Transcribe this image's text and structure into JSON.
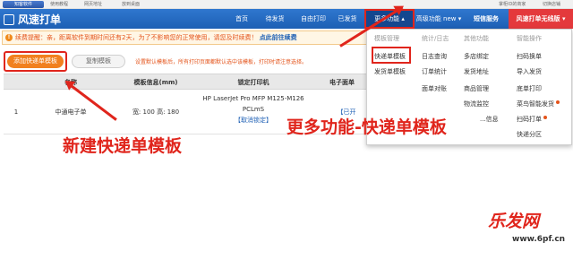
{
  "topbar": {
    "logo": "知客软件",
    "links": [
      "使用教程",
      "网页地址",
      "放到桌面"
    ],
    "user": "掌柜ID的商家",
    "switch": "切换店铺"
  },
  "header": {
    "app_title": "风速打单",
    "nav": [
      {
        "label": "首页"
      },
      {
        "label": "待发货"
      },
      {
        "label": "自由打印"
      },
      {
        "label": "已发货"
      },
      {
        "label": "更多功能 ▴"
      },
      {
        "label": "高级功能 new ▾"
      },
      {
        "label": "短信服务"
      },
      {
        "label": "风速打单无线版 ▾"
      }
    ]
  },
  "notice": {
    "text": "续费提醒：亲，距离软件到期时间还有2天，为了不影响您的正常使用，请您及时续费！",
    "link": "点此前往续费"
  },
  "toolbar": {
    "add_label": "添加快递单模板",
    "copy_label": "复制模板",
    "tip": "设置默认模板后，所有打印页面都默认选中该模板，打印时请注意选择。"
  },
  "table": {
    "headers": [
      "",
      "名称",
      "模板信息(mm)",
      "锁定打印机",
      "电子面单"
    ],
    "rows": [
      {
        "index": "1",
        "name": "中通电子单",
        "size": "宽: 100    高: 180",
        "printer_line1": "HP LaserJet Pro MFP M125-M126",
        "printer_line2": "PCLmS",
        "printer_change": "【取消锁定】",
        "extra": "【已开"
      }
    ]
  },
  "dropdown": {
    "columns": [
      {
        "head": "模板管理",
        "items": [
          "快递单模板",
          "发货单模板"
        ]
      },
      {
        "head": "统计/日志",
        "items": [
          "日志查询",
          "订单统计",
          "面单对账"
        ]
      },
      {
        "head": "其他功能",
        "items": [
          "多店绑定",
          "发货地址",
          "商品管理",
          "物流监控",
          "...信息"
        ]
      },
      {
        "head": "智能操作",
        "items": [
          "扫码换单",
          "导入发货",
          "底单打印",
          "菜鸟智能发货",
          "扫码打单",
          "快递分区"
        ]
      }
    ]
  },
  "annotations": {
    "left": "新建快递单模板",
    "right": "更多功能-快递单模板"
  },
  "watermark": {
    "text": "乐发网",
    "url": "www.6pf.cn"
  }
}
